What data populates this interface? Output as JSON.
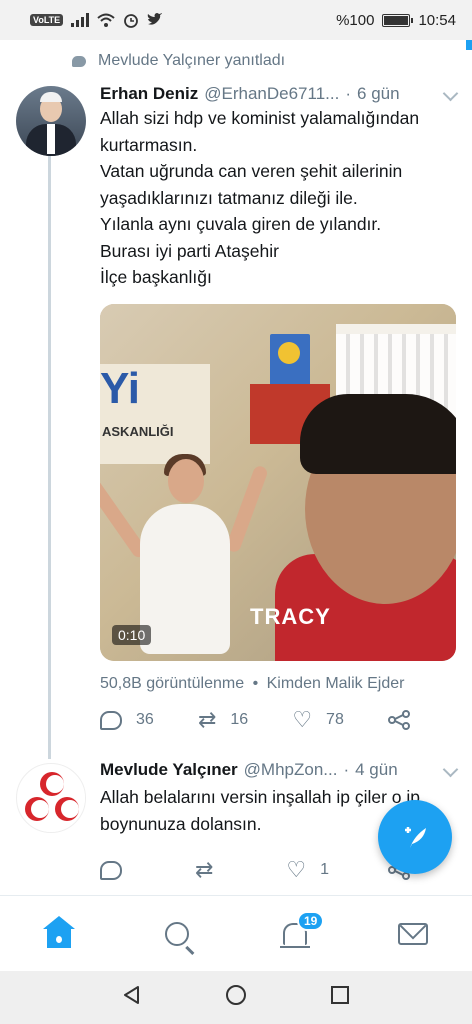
{
  "status_bar": {
    "volte": "VoLTE",
    "battery_text": "%100",
    "time": "10:54"
  },
  "thread": {
    "replied_by": "Mevlude Yalçıner yanıtladı"
  },
  "tweet1": {
    "name": "Erhan Deniz",
    "handle": "@ErhanDe6711...",
    "dot": "·",
    "time": "6 gün",
    "lines": [
      "Allah sizi hdp ve kominist yalamalığından",
      "kurtarmasın.",
      "Vatan uğrunda can veren şehit ailerinin",
      "yaşadıklarınızı tatmanız dileği ile.",
      "Yılanla aynı çuvala giren de yılandır.",
      "Burası iyi parti Ataşehir",
      "İlçe başkanlığı"
    ],
    "video_duration": "0:10",
    "video_sign": "ASKANLIĞI",
    "video_logo": "Yi",
    "video_jersey": "TRACY",
    "views": "50,8B görüntülenme",
    "from_sep": "•",
    "from": "Kimden Malik Ejder",
    "replies": "36",
    "retweets": "16",
    "likes": "78"
  },
  "tweet2": {
    "name": "Mevlude Yalçıner",
    "handle": "@MhpZon...",
    "dot": "·",
    "time": "4 gün",
    "lines": [
      "Allah belalarını versin inşallah ip çiler o ip",
      "boynunuza dolansın."
    ],
    "replies": "",
    "retweets": "",
    "likes": "1"
  },
  "tabbar": {
    "notifications_badge": "19"
  },
  "icons": {
    "fab": "compose-tweet-icon",
    "home": "home-icon",
    "search": "search-icon",
    "notifications": "bell-icon",
    "messages": "mail-icon"
  },
  "colors": {
    "accent": "#1da1f2",
    "muted": "#657786",
    "text": "#14171a"
  }
}
